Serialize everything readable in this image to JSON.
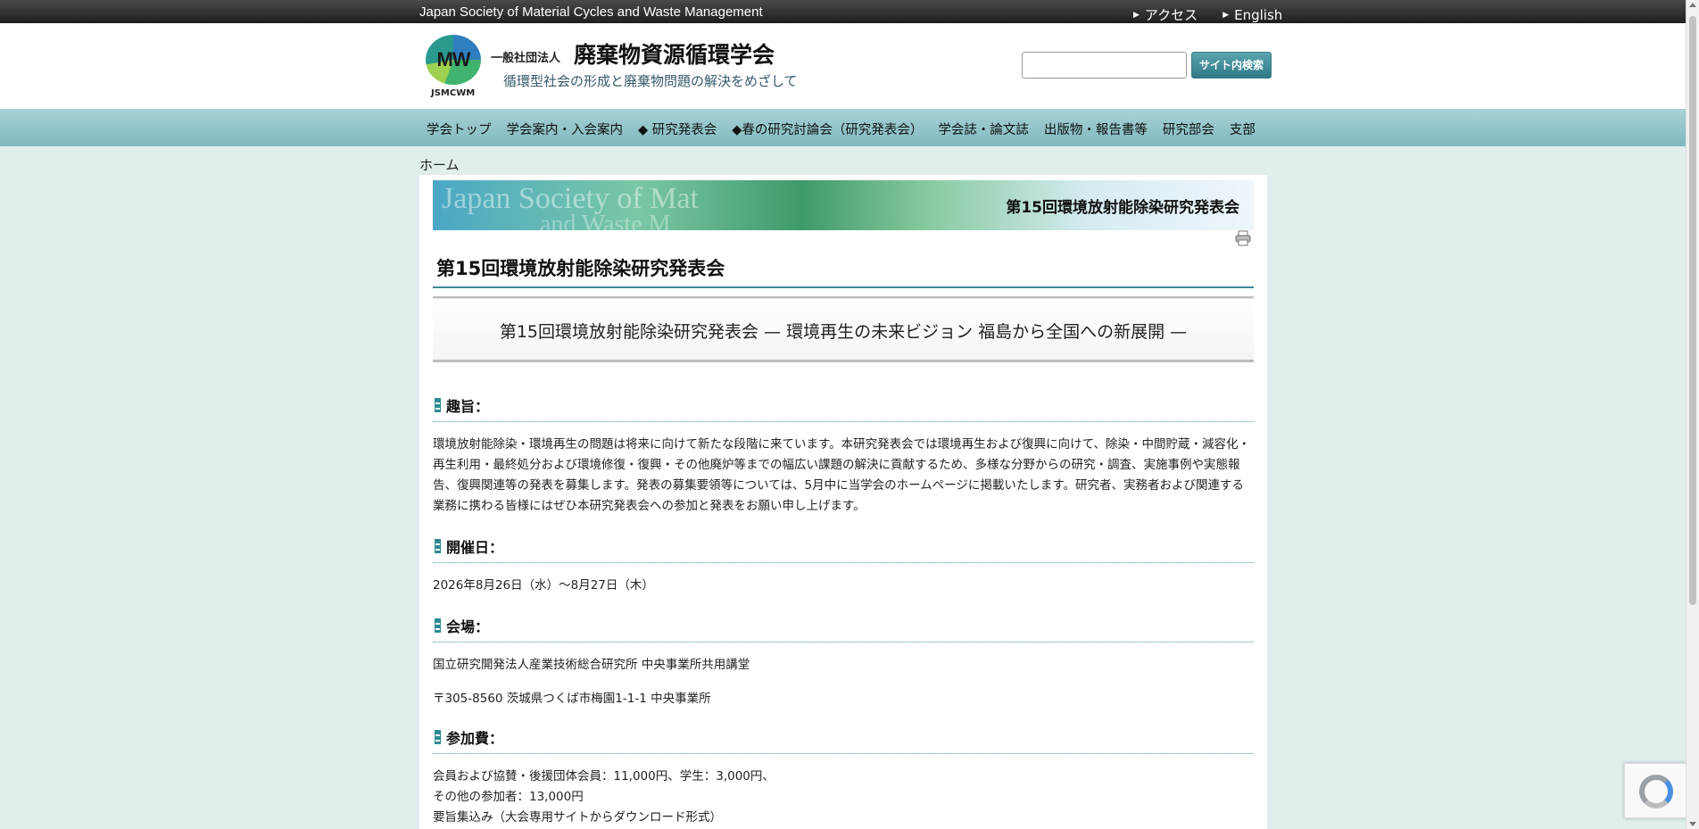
{
  "topbar": {
    "org_en": "Japan Society of Material Cycles and Waste Management",
    "links": [
      {
        "label": "アクセス"
      },
      {
        "label": "English"
      }
    ]
  },
  "header": {
    "logo_mark": "MW",
    "logo_abbr": "JSMCWM",
    "prefix": "一般社団法人",
    "title": "廃棄物資源循環学会",
    "subtitle": "循環型社会の形成と廃棄物問題の解決をめざして",
    "search": {
      "value": "",
      "button_label": "サイト内検索"
    }
  },
  "nav": {
    "items": [
      {
        "label": "学会トップ"
      },
      {
        "label": "学会案内・入会案内"
      },
      {
        "label": "◆ 研究発表会"
      },
      {
        "label": "◆春の研究討論会（研究発表会）"
      },
      {
        "label": "学会誌・論文誌"
      },
      {
        "label": "出版物・報告書等"
      },
      {
        "label": "研究部会"
      },
      {
        "label": "支部"
      }
    ]
  },
  "breadcrumb": "ホーム",
  "banner": {
    "watermark_1": "Japan Society of Mat",
    "watermark_2": "and Waste M",
    "title": "第15回環境放射能除染研究発表会"
  },
  "page": {
    "title": "第15回環境放射能除染研究発表会",
    "subtitle": "第15回環境放射能除染研究発表会 — 環境再生の未来ビジョン 福島から全国への新展開 —",
    "sections": {
      "purpose": {
        "heading": "趣旨：",
        "text": "環境放射能除染・環境再生の問題は将来に向けて新たな段階に来ています。本研究発表会では環境再生および復興に向けて、除染・中間貯蔵・減容化・再生利用・最終処分および環境修復・復興・その他廃炉等までの幅広い課題の解決に貢献するため、多様な分野からの研究・調査、実施事例や実態報告、復興関連等の発表を募集します。発表の募集要領等については、5月中に当学会のホームページに掲載いたします。研究者、実務者および関連する業務に携わる皆様にはぜひ本研究発表会への参加と発表をお願い申し上げます。"
      },
      "date": {
        "heading": "開催日：",
        "text": "2026年8月26日（水）～8月27日（木）"
      },
      "venue": {
        "heading": "会場：",
        "line1": "国立研究開発法人産業技術総合研究所 中央事業所共用講堂",
        "line2": "〒305-8560 茨城県つくば市梅園1-1-1 中央事業所"
      },
      "fee": {
        "heading": "参加費：",
        "line1": "会員および協賛・後援団体会員：11,000円、学生：3,000円、",
        "line2": "その他の参加者：13,000円",
        "line3": "要旨集込み（大会専用サイトからダウンロード形式）"
      }
    }
  }
}
